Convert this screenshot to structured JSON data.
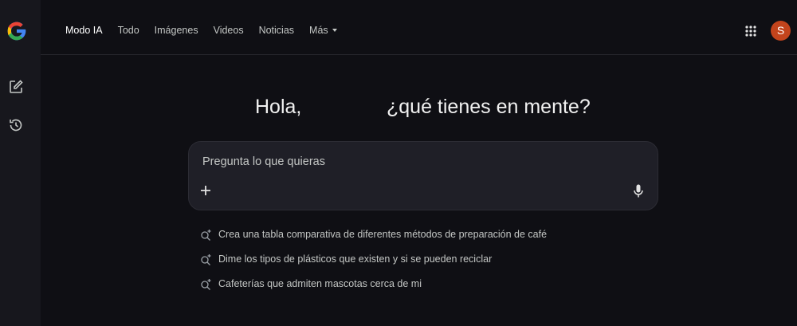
{
  "nav": {
    "tabs": [
      {
        "label": "Modo IA"
      },
      {
        "label": "Todo"
      },
      {
        "label": "Imágenes"
      },
      {
        "label": "Videos"
      },
      {
        "label": "Noticias"
      },
      {
        "label": "Más"
      }
    ]
  },
  "avatar": {
    "initial": "S",
    "color": "#c3441c"
  },
  "greeting": {
    "hola": "Hola,",
    "rest": "¿qué tienes en mente?"
  },
  "prompt": {
    "placeholder": "Pregunta lo que quieras",
    "value": ""
  },
  "suggestions": [
    {
      "text": "Crea una tabla comparativa de diferentes métodos de preparación de café"
    },
    {
      "text": "Dime los tipos de plásticos que existen y si se pueden reciclar"
    },
    {
      "text": "Cafeterías que admiten mascotas cerca de mi"
    }
  ],
  "icons": {
    "logo": "google-g-icon",
    "new_chat": "edit-note-icon",
    "history": "history-icon",
    "apps": "apps-grid-icon",
    "add": "plus-icon",
    "mic": "microphone-icon",
    "suggestion": "search-sparkle-icon"
  },
  "colors": {
    "background": "#0f0f14",
    "sidebar": "#17171d",
    "input_box": "#1f1f27",
    "avatar": "#c3441c"
  }
}
